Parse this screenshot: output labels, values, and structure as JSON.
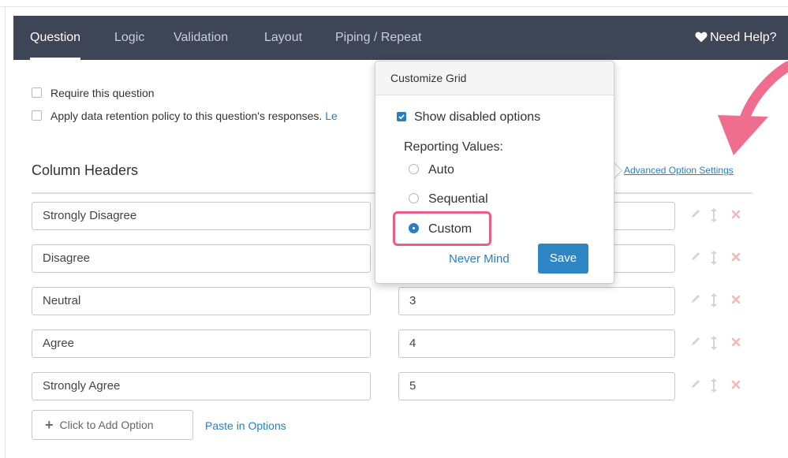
{
  "nav": {
    "tabs": [
      {
        "label": "Question",
        "active": true
      },
      {
        "label": "Logic"
      },
      {
        "label": "Validation"
      },
      {
        "label": "Layout"
      },
      {
        "label": "Piping / Repeat"
      }
    ],
    "help_label": "Need Help?"
  },
  "options": {
    "require_label": "Require this question",
    "retention_label": "Apply data retention policy to this question's responses.",
    "retention_link": "Le"
  },
  "section": {
    "title": "Column Headers",
    "advanced_link": "Advanced Option Settings"
  },
  "rows": [
    {
      "label": "Strongly Disagree",
      "value": ""
    },
    {
      "label": "Disagree",
      "value": ""
    },
    {
      "label": "Neutral",
      "value": "3"
    },
    {
      "label": "Agree",
      "value": "4"
    },
    {
      "label": "Strongly Agree",
      "value": "5"
    }
  ],
  "footer": {
    "add_label": "Click to Add Option",
    "paste_label": "Paste in Options"
  },
  "popover": {
    "title": "Customize Grid",
    "show_disabled_label": "Show disabled options",
    "show_disabled_checked": true,
    "reporting_label": "Reporting Values:",
    "radio_options": [
      "Auto",
      "Sequential",
      "Custom"
    ],
    "selected": "Custom",
    "cancel_label": "Never Mind",
    "save_label": "Save"
  },
  "colors": {
    "navbar": "#3d4556",
    "accent": "#2b7ec2",
    "highlight": "#ea5e84"
  }
}
